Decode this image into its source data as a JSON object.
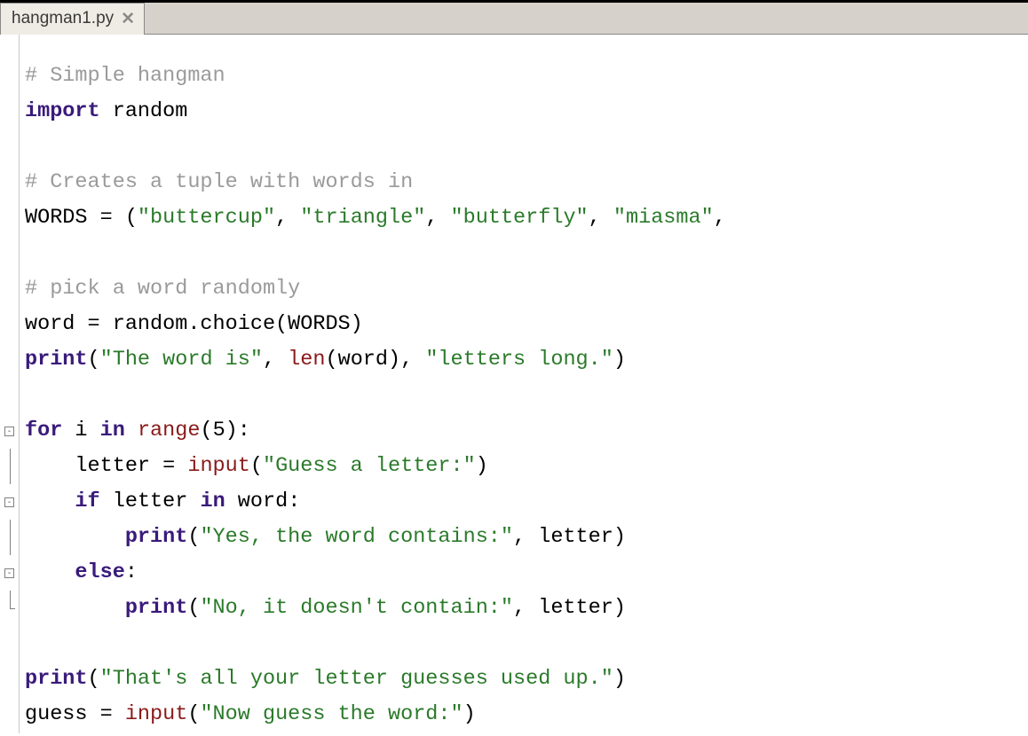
{
  "tab": {
    "filename": "hangman1.py",
    "close_glyph": "✕"
  },
  "gutter": {
    "rows": [
      {
        "t": "blank"
      },
      {
        "t": "blank"
      },
      {
        "t": "blank"
      },
      {
        "t": "blank"
      },
      {
        "t": "blank"
      },
      {
        "t": "blank"
      },
      {
        "t": "blank"
      },
      {
        "t": "blank"
      },
      {
        "t": "blank"
      },
      {
        "t": "blank"
      },
      {
        "t": "fold",
        "glyph": "-"
      },
      {
        "t": "vline"
      },
      {
        "t": "fold",
        "glyph": "-"
      },
      {
        "t": "vline"
      },
      {
        "t": "fold",
        "glyph": "-"
      },
      {
        "t": "corner"
      },
      {
        "t": "blank"
      },
      {
        "t": "blank"
      },
      {
        "t": "blank"
      }
    ]
  },
  "code": {
    "lines": [
      [
        {
          "c": "cmt",
          "t": "# Simple hangman"
        }
      ],
      [
        {
          "c": "kw",
          "t": "import"
        },
        {
          "c": "",
          "t": " random"
        }
      ],
      [],
      [
        {
          "c": "cmt",
          "t": "# Creates a tuple with words in"
        }
      ],
      [
        {
          "c": "",
          "t": "WORDS = ("
        },
        {
          "c": "str",
          "t": "\"buttercup\""
        },
        {
          "c": "",
          "t": ", "
        },
        {
          "c": "str",
          "t": "\"triangle\""
        },
        {
          "c": "",
          "t": ", "
        },
        {
          "c": "str",
          "t": "\"butterfly\""
        },
        {
          "c": "",
          "t": ", "
        },
        {
          "c": "str",
          "t": "\"miasma\""
        },
        {
          "c": "",
          "t": ","
        }
      ],
      [],
      [
        {
          "c": "cmt",
          "t": "# pick a word randomly"
        }
      ],
      [
        {
          "c": "",
          "t": "word = random.choice(WORDS)"
        }
      ],
      [
        {
          "c": "kw",
          "t": "print"
        },
        {
          "c": "",
          "t": "("
        },
        {
          "c": "str",
          "t": "\"The word is\""
        },
        {
          "c": "",
          "t": ", "
        },
        {
          "c": "fn",
          "t": "len"
        },
        {
          "c": "",
          "t": "(word), "
        },
        {
          "c": "str",
          "t": "\"letters long.\""
        },
        {
          "c": "",
          "t": ")"
        }
      ],
      [],
      [
        {
          "c": "kw",
          "t": "for"
        },
        {
          "c": "",
          "t": " i "
        },
        {
          "c": "kw",
          "t": "in"
        },
        {
          "c": "",
          "t": " "
        },
        {
          "c": "fn",
          "t": "range"
        },
        {
          "c": "",
          "t": "(5):"
        }
      ],
      [
        {
          "c": "",
          "t": "    letter = "
        },
        {
          "c": "fn",
          "t": "input"
        },
        {
          "c": "",
          "t": "("
        },
        {
          "c": "str",
          "t": "\"Guess a letter:\""
        },
        {
          "c": "",
          "t": ")"
        }
      ],
      [
        {
          "c": "",
          "t": "    "
        },
        {
          "c": "kw",
          "t": "if"
        },
        {
          "c": "",
          "t": " letter "
        },
        {
          "c": "kw",
          "t": "in"
        },
        {
          "c": "",
          "t": " word:"
        }
      ],
      [
        {
          "c": "",
          "t": "        "
        },
        {
          "c": "kw",
          "t": "print"
        },
        {
          "c": "",
          "t": "("
        },
        {
          "c": "str",
          "t": "\"Yes, the word contains:\""
        },
        {
          "c": "",
          "t": ", letter)"
        }
      ],
      [
        {
          "c": "",
          "t": "    "
        },
        {
          "c": "kw",
          "t": "else"
        },
        {
          "c": "",
          "t": ":"
        }
      ],
      [
        {
          "c": "",
          "t": "        "
        },
        {
          "c": "kw",
          "t": "print"
        },
        {
          "c": "",
          "t": "("
        },
        {
          "c": "str",
          "t": "\"No, it doesn't contain:\""
        },
        {
          "c": "",
          "t": ", letter)"
        }
      ],
      [],
      [
        {
          "c": "kw",
          "t": "print"
        },
        {
          "c": "",
          "t": "("
        },
        {
          "c": "str",
          "t": "\"That's all your letter guesses used up.\""
        },
        {
          "c": "",
          "t": ")"
        }
      ],
      [
        {
          "c": "",
          "t": "guess = "
        },
        {
          "c": "fn",
          "t": "input"
        },
        {
          "c": "",
          "t": "("
        },
        {
          "c": "str",
          "t": "\"Now guess the word:\""
        },
        {
          "c": "",
          "t": ")"
        }
      ]
    ]
  }
}
